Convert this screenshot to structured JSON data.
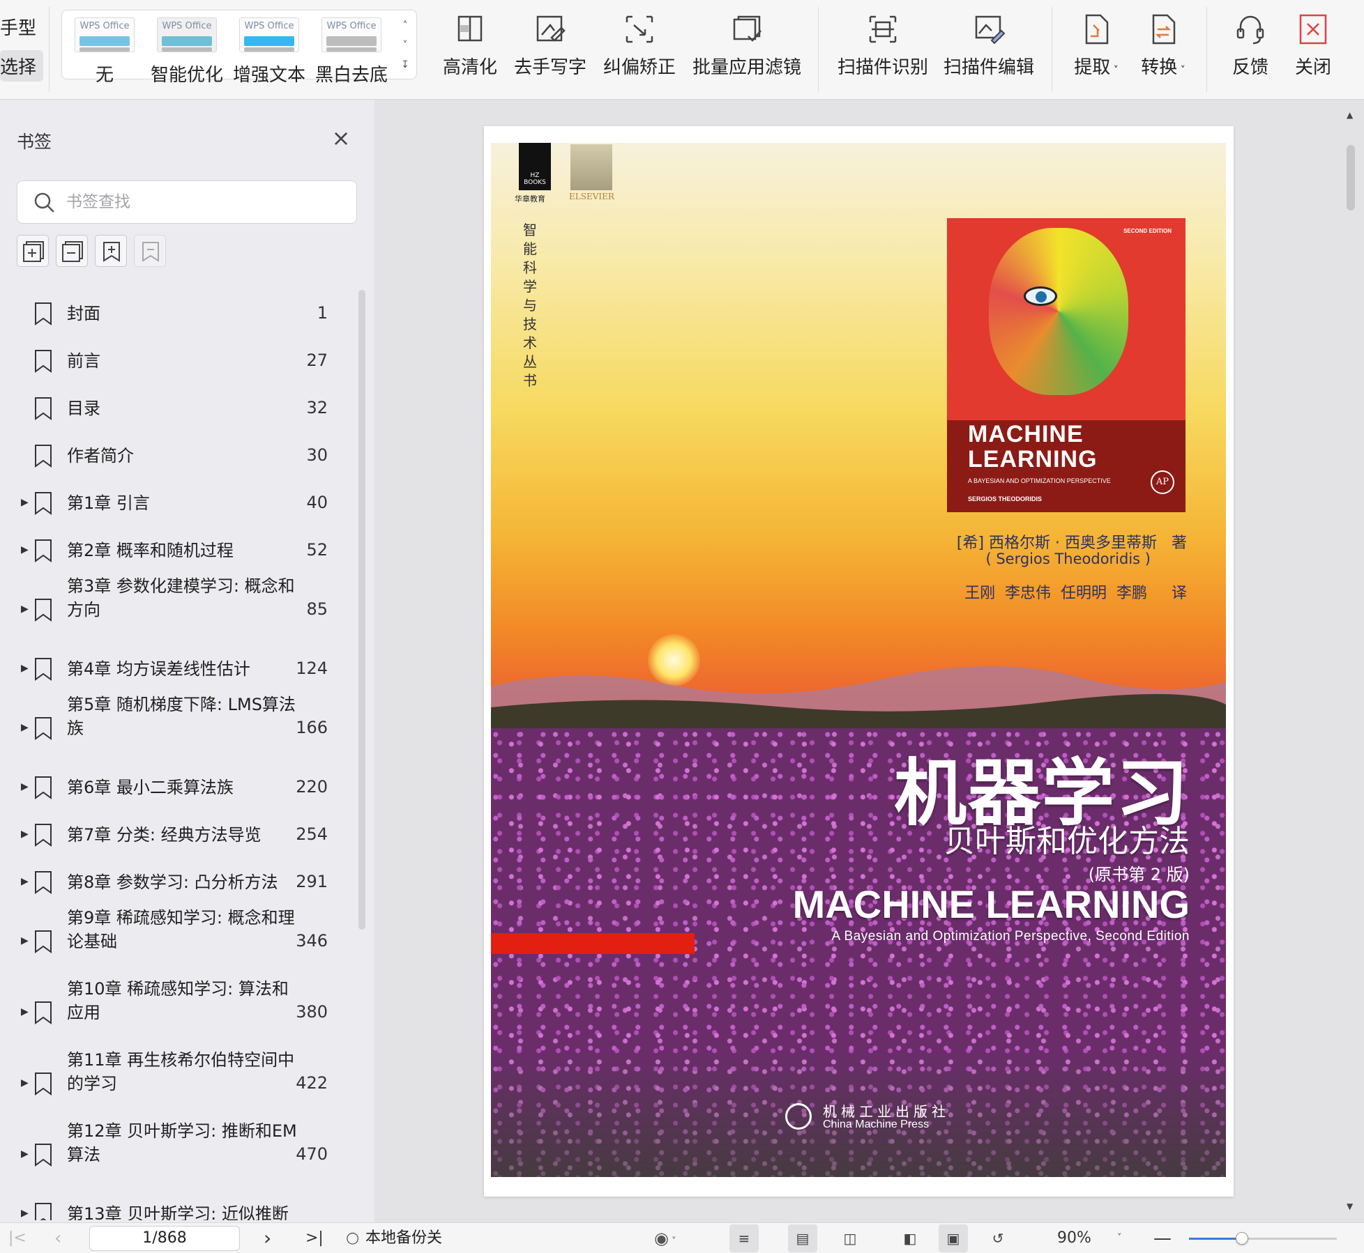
{
  "toolbar": {
    "left_label_1": "手型",
    "left_label_2": "选择",
    "filters": [
      {
        "brand": "WPS Office",
        "label": "无",
        "band": "#77c3e6"
      },
      {
        "brand": "WPS Office",
        "label": "智能优化",
        "band": "#6fbfd6"
      },
      {
        "brand": "WPS Office",
        "label": "增强文本",
        "band": "#37b7f0"
      },
      {
        "brand": "WPS Office",
        "label": "黑白去底",
        "band": "#bdbdbd"
      }
    ],
    "tools": [
      {
        "label": "高清化",
        "icon": "hd-icon"
      },
      {
        "label": "去手写字",
        "icon": "erase-handwriting-icon"
      },
      {
        "label": "纠偏矫正",
        "icon": "deskew-icon"
      },
      {
        "label": "批量应用滤镜",
        "icon": "batch-filter-icon"
      },
      {
        "label": "扫描件识别",
        "icon": "scan-recognize-icon"
      },
      {
        "label": "扫描件编辑",
        "icon": "scan-edit-icon"
      },
      {
        "label": "提取",
        "icon": "extract-icon",
        "dropdown": true
      },
      {
        "label": "转换",
        "icon": "convert-icon",
        "dropdown": true
      },
      {
        "label": "反馈",
        "icon": "feedback-icon"
      },
      {
        "label": "关闭",
        "icon": "close-icon"
      }
    ]
  },
  "sidebar": {
    "title": "书签",
    "search_placeholder": "书签查找",
    "items": [
      {
        "title": "封面",
        "page": "1",
        "expandable": false
      },
      {
        "title": "前言",
        "page": "27",
        "expandable": false
      },
      {
        "title": "目录",
        "page": "32",
        "expandable": false
      },
      {
        "title": "作者简介",
        "page": "30",
        "expandable": false
      },
      {
        "title": "第1章 引言",
        "page": "40",
        "expandable": true
      },
      {
        "title": "第2章 概率和随机过程",
        "page": "52",
        "expandable": true
      },
      {
        "title": "第3章 参数化建模学习: 概念和方向",
        "page": "85",
        "expandable": true
      },
      {
        "title": "第4章 均方误差线性估计",
        "page": "124",
        "expandable": true
      },
      {
        "title": "第5章 随机梯度下降: LMS算法族",
        "page": "166",
        "expandable": true
      },
      {
        "title": "第6章 最小二乘算法族",
        "page": "220",
        "expandable": true
      },
      {
        "title": "第7章 分类: 经典方法导览",
        "page": "254",
        "expandable": true
      },
      {
        "title": "第8章 参数学习: 凸分析方法",
        "page": "291",
        "expandable": true
      },
      {
        "title": "第9章 稀疏感知学习: 概念和理论基础",
        "page": "346",
        "expandable": true
      },
      {
        "title": "第10章 稀疏感知学习: 算法和应用",
        "page": "380",
        "expandable": true
      },
      {
        "title": "第11章 再生核希尔伯特空间中的学习",
        "page": "422",
        "expandable": true
      },
      {
        "title": "第12章 贝叶斯学习: 推断和EM算法",
        "page": "470",
        "expandable": true
      },
      {
        "title": "第13章 贝叶斯学习: 近似推断",
        "page": "",
        "expandable": true
      }
    ]
  },
  "cover": {
    "publisher_logo_text": "HZ BOOKS",
    "publisher_logo_caption": "华章教育",
    "elsevier": "ELSEVIER",
    "series": "智能科学与技术丛书",
    "book": {
      "edition": "SECOND EDITION",
      "title": "MACHINE\nLEARNING",
      "subtitle": "A BAYESIAN AND OPTIMIZATION PERSPECTIVE",
      "author": "SERGIOS THEODORIDIS",
      "ap": "AP"
    },
    "author_line": "[希] 西格尔斯 · 西奥多里蒂斯   著",
    "author_en": "( Sergios Theodoridis )",
    "translators": "王刚  李忠伟  任明明  李鹏     译",
    "title_cn": "机器学习",
    "subtitle_cn": "贝叶斯和优化方法",
    "edition_cn": "(原书第 2 版)",
    "title_en": "MACHINE LEARNING",
    "subtitle_en": "A Bayesian and Optimization Perspective, Second Edition",
    "publisher_cn": "机械工业出版社",
    "publisher_en": "China Machine Press"
  },
  "status": {
    "page_indicator": "1/868",
    "backup": "本地备份关",
    "zoom": "90%",
    "zoom_fraction": 0.36
  }
}
